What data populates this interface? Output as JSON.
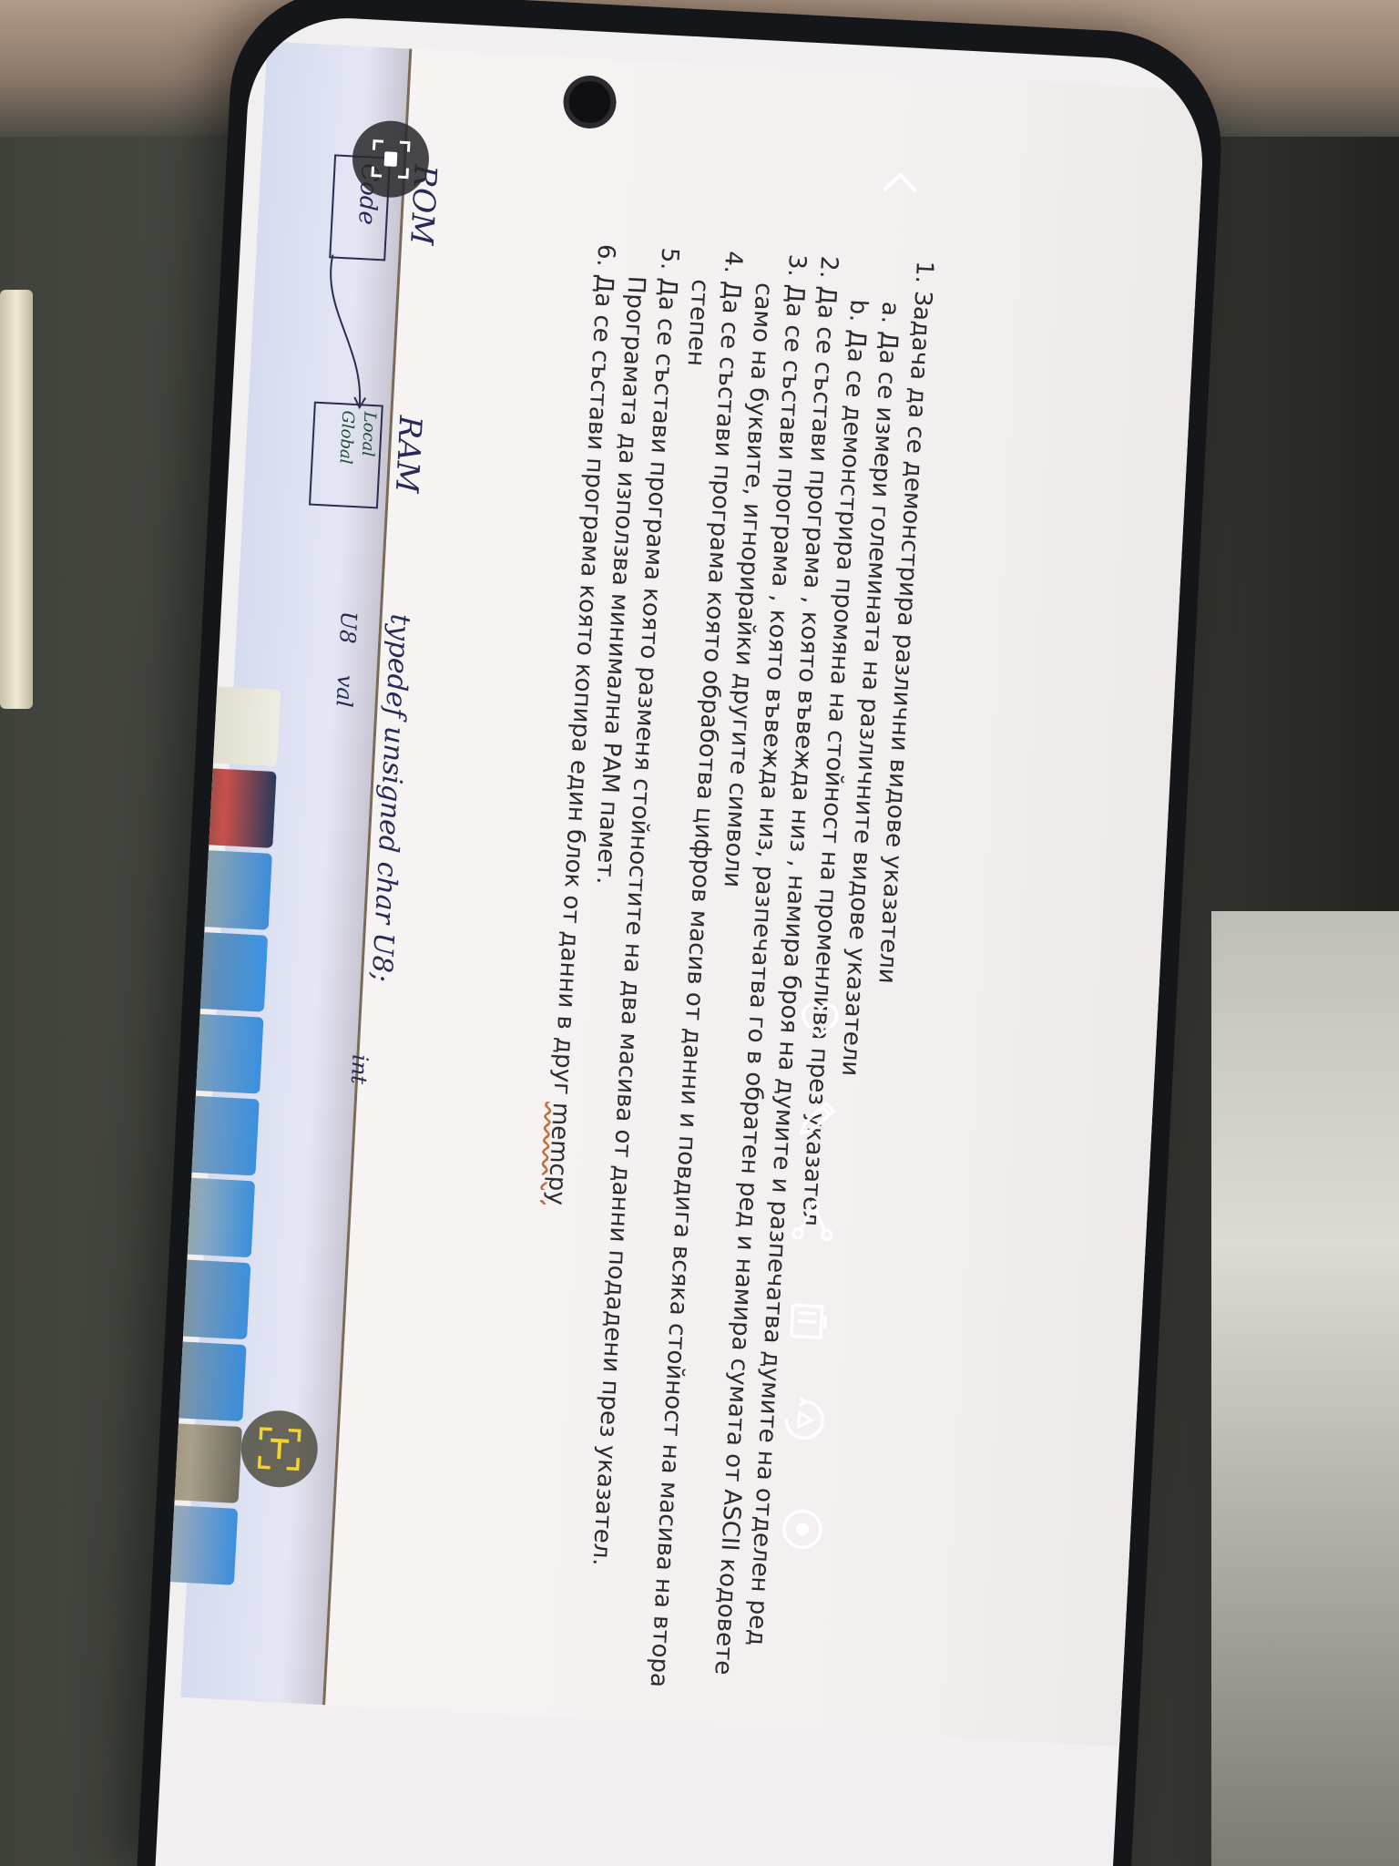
{
  "document": {
    "items": [
      "Задача да се демонстрира различни видове указатели",
      "Да се състави програма , която въвежда низ , намира броя на думите и разпечатва думите на отделен ред",
      "Да се състави програма , която въвежда низ, разпечатва го в обратен ред и намира сумата от ASCII кодовете само на буквите, игнорирайки другите символи",
      "Да се състави програма която обработва цифров масив от данни и повдига всяка стойност на масива на втора степен",
      "Да се състави програма която разменя стойностите на два масива от данни подадени през указател. Програмата да използва минимална РАМ памет.",
      "Да се състави програма която копира един блок от данни в друг "
    ],
    "sub_items": [
      "Да се измери големината на различните видове указатели",
      "Да се демонстрира промяна на стойност на променлива през указател"
    ],
    "memcpy": "memcpy"
  },
  "handwriting": {
    "rom": "ROM",
    "code": "Code",
    "ram": "RAM",
    "local": "Local",
    "global": "Global",
    "typedef": "typedef unsigned char U8;",
    "u8": "U8",
    "val": "val",
    "int": "int"
  },
  "icons": {
    "back": "chevron-up-icon",
    "favorite": "heart-icon",
    "edit": "pencil-icon",
    "share": "share-icon",
    "delete": "trash-icon",
    "rotate": "rotate-icon",
    "visibility": "eye-icon",
    "scan": "scan-icon",
    "text_extract": "text-extract-icon"
  },
  "colors": {
    "screen_bg": "#f3efef",
    "text": "#2d2b2e",
    "ink": "#262a55",
    "icon": "#ffffff",
    "text_extract_accent": "#f5d32a"
  }
}
